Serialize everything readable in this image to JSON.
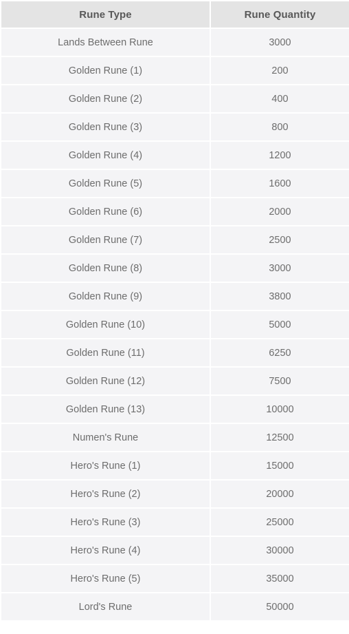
{
  "chart_data": {
    "type": "table",
    "title": "",
    "columns": [
      "Rune Type",
      "Rune Quantity"
    ],
    "categories": [
      "Lands Between Rune",
      "Golden Rune (1)",
      "Golden Rune (2)",
      "Golden Rune (3)",
      "Golden Rune (4)",
      "Golden Rune (5)",
      "Golden Rune (6)",
      "Golden Rune (7)",
      "Golden Rune (8)",
      "Golden Rune (9)",
      "Golden Rune (10)",
      "Golden Rune (11)",
      "Golden Rune (12)",
      "Golden Rune (13)",
      "Numen's Rune",
      "Hero's Rune (1)",
      "Hero's Rune (2)",
      "Hero's Rune (3)",
      "Hero's Rune (4)",
      "Hero's Rune (5)",
      "Lord's Rune"
    ],
    "values": [
      3000,
      200,
      400,
      800,
      1200,
      1600,
      2000,
      2500,
      3000,
      3800,
      5000,
      6250,
      7500,
      10000,
      12500,
      15000,
      20000,
      25000,
      30000,
      35000,
      50000
    ],
    "xlabel": "Rune Type",
    "ylabel": "Rune Quantity",
    "grid": true,
    "legend": false
  },
  "table": {
    "header": {
      "type_label": "Rune Type",
      "quantity_label": "Rune Quantity"
    },
    "rows": [
      {
        "type": "Lands Between Rune",
        "quantity": "3000"
      },
      {
        "type": "Golden Rune (1)",
        "quantity": "200"
      },
      {
        "type": "Golden Rune (2)",
        "quantity": "400"
      },
      {
        "type": "Golden Rune (3)",
        "quantity": "800"
      },
      {
        "type": "Golden Rune (4)",
        "quantity": "1200"
      },
      {
        "type": "Golden Rune (5)",
        "quantity": "1600"
      },
      {
        "type": "Golden Rune (6)",
        "quantity": "2000"
      },
      {
        "type": "Golden Rune (7)",
        "quantity": "2500"
      },
      {
        "type": "Golden Rune (8)",
        "quantity": "3000"
      },
      {
        "type": "Golden Rune (9)",
        "quantity": "3800"
      },
      {
        "type": "Golden Rune (10)",
        "quantity": "5000"
      },
      {
        "type": "Golden Rune (11)",
        "quantity": "6250"
      },
      {
        "type": "Golden Rune (12)",
        "quantity": "7500"
      },
      {
        "type": "Golden Rune (13)",
        "quantity": "10000"
      },
      {
        "type": "Numen's Rune",
        "quantity": "12500"
      },
      {
        "type": "Hero's Rune (1)",
        "quantity": "15000"
      },
      {
        "type": "Hero's Rune (2)",
        "quantity": "20000"
      },
      {
        "type": "Hero's Rune (3)",
        "quantity": "25000"
      },
      {
        "type": "Hero's Rune (4)",
        "quantity": "30000"
      },
      {
        "type": "Hero's Rune (5)",
        "quantity": "35000"
      },
      {
        "type": "Lord's Rune",
        "quantity": "50000"
      }
    ]
  },
  "colors": {
    "header_background": "#e4e4e4",
    "header_text": "#585858",
    "cell_background": "#f4f4f6",
    "cell_text": "#6d6d6d",
    "page_background": "#ffffff"
  }
}
